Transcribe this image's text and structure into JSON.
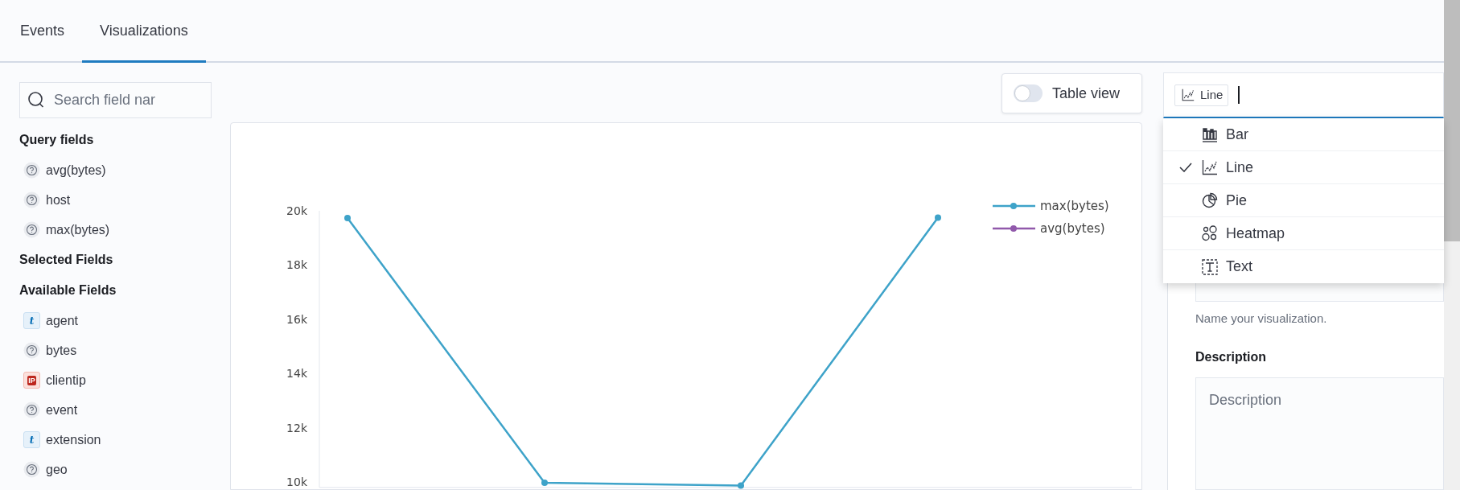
{
  "tabs": [
    {
      "label": "Events",
      "selected": false
    },
    {
      "label": "Visualizations",
      "selected": true
    }
  ],
  "sidebar": {
    "search": {
      "placeholder": "Search field nar"
    },
    "sections": [
      {
        "title": "Query fields",
        "fields": [
          {
            "name": "avg(bytes)",
            "kind": "unknown"
          },
          {
            "name": "host",
            "kind": "unknown"
          },
          {
            "name": "max(bytes)",
            "kind": "unknown"
          }
        ]
      },
      {
        "title": "Selected Fields"
      },
      {
        "title": "Available Fields",
        "fields": [
          {
            "name": "agent",
            "kind": "string",
            "badge": "t"
          },
          {
            "name": "bytes",
            "kind": "unknown"
          },
          {
            "name": "clientip",
            "kind": "ip",
            "badge": "IP"
          },
          {
            "name": "event",
            "kind": "unknown"
          },
          {
            "name": "extension",
            "kind": "string",
            "badge": "t"
          },
          {
            "name": "geo",
            "kind": "unknown"
          }
        ]
      }
    ]
  },
  "table_view": {
    "label": "Table view",
    "on": false
  },
  "chart": {
    "chart_data": {
      "type": "line",
      "ylim": [
        9800,
        20000
      ],
      "yticks": [
        {
          "value": 10000,
          "label": "10k"
        },
        {
          "value": 12000,
          "label": "12k"
        },
        {
          "value": 14000,
          "label": "14k"
        },
        {
          "value": 16000,
          "label": "16k"
        },
        {
          "value": 18000,
          "label": "18k"
        },
        {
          "value": 20000,
          "label": "20k"
        }
      ],
      "series": [
        {
          "name": "max(bytes)",
          "color": "#3ea3c9",
          "marker": true,
          "values": [
            19730,
            9970,
            9870,
            19750
          ]
        },
        {
          "name": "avg(bytes)",
          "color": "#9159ab",
          "marker": true,
          "values": [
            null,
            null,
            null,
            null
          ]
        }
      ]
    }
  },
  "visualization_type": {
    "value": "Line",
    "options": [
      {
        "label": "Bar",
        "kind": "bar",
        "selected": false
      },
      {
        "label": "Line",
        "kind": "line",
        "selected": true
      },
      {
        "label": "Pie",
        "kind": "pie",
        "selected": false
      },
      {
        "label": "Heatmap",
        "kind": "heatmap",
        "selected": false
      },
      {
        "label": "Text",
        "kind": "text",
        "selected": false
      }
    ]
  },
  "name_hint": "Name your visualization.",
  "description": {
    "label": "Description",
    "placeholder": "Description"
  }
}
